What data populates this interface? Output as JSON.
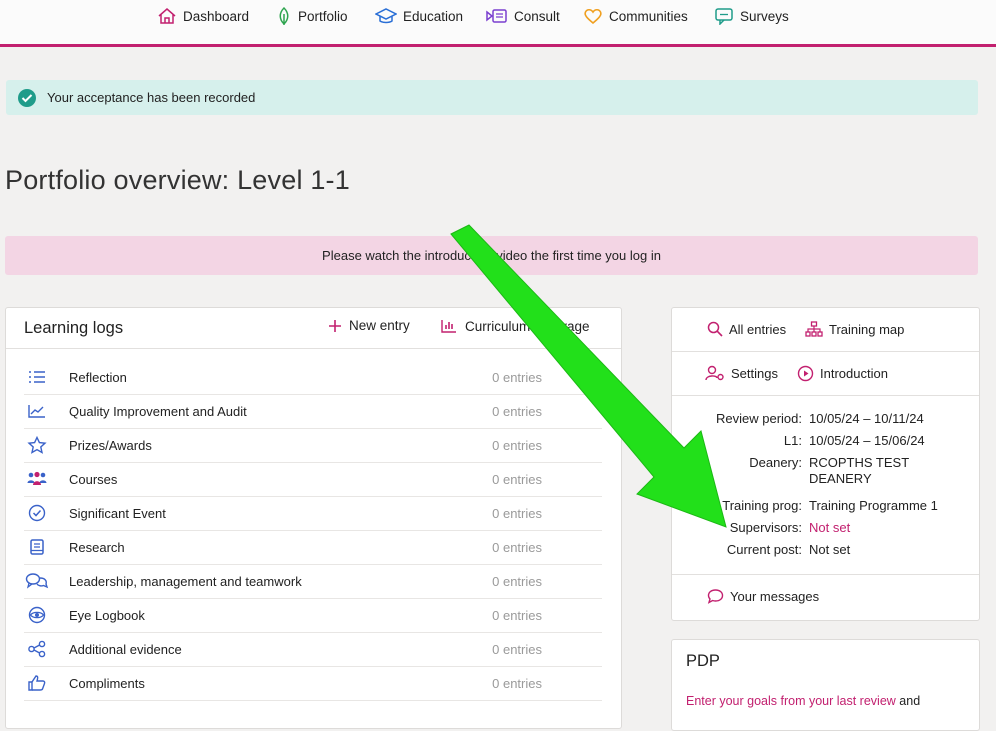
{
  "nav": {
    "items": [
      {
        "label": "Dashboard",
        "icon": "home-icon"
      },
      {
        "label": "Portfolio",
        "icon": "leaf-icon"
      },
      {
        "label": "Education",
        "icon": "graduation-cap-icon"
      },
      {
        "label": "Consult",
        "icon": "video-call-icon"
      },
      {
        "label": "Communities",
        "icon": "heart-icon"
      },
      {
        "label": "Surveys",
        "icon": "chat-survey-icon"
      }
    ]
  },
  "alert": {
    "text": "Your acceptance has been recorded"
  },
  "page": {
    "title": "Portfolio overview: Level 1-1"
  },
  "notice": {
    "text": "Please watch the introductory video the first time you log in"
  },
  "logs": {
    "title": "Learning logs",
    "new_entry": "New entry",
    "curriculum": "Curriculum coverage",
    "rows": [
      {
        "label": "Reflection",
        "count": "0 entries",
        "icon": "list-icon"
      },
      {
        "label": "Quality Improvement and Audit",
        "count": "0 entries",
        "icon": "line-chart-icon"
      },
      {
        "label": "Prizes/Awards",
        "count": "0 entries",
        "icon": "star-icon"
      },
      {
        "label": "Courses",
        "count": "0 entries",
        "icon": "group-icon"
      },
      {
        "label": "Significant Event",
        "count": "0 entries",
        "icon": "check-circle-icon"
      },
      {
        "label": "Research",
        "count": "0 entries",
        "icon": "book-icon"
      },
      {
        "label": "Leadership, management and teamwork",
        "count": "0 entries",
        "icon": "chat-bubbles-icon"
      },
      {
        "label": "Eye Logbook",
        "count": "0 entries",
        "icon": "eye-icon"
      },
      {
        "label": "Additional evidence",
        "count": "0 entries",
        "icon": "share-icon"
      },
      {
        "label": "Compliments",
        "count": "0 entries",
        "icon": "thumbs-up-icon"
      }
    ]
  },
  "side": {
    "all_entries": "All entries",
    "training_map": "Training map",
    "settings": "Settings",
    "introduction": "Introduction",
    "info": [
      {
        "key": "Review period:",
        "value": "10/05/24 – 10/11/24"
      },
      {
        "key": "L1:",
        "value": "10/05/24 – 15/06/24"
      },
      {
        "key": "Deanery:",
        "value": "RCOPTHS TEST DEANERY"
      },
      {
        "key": "Training prog:",
        "value": "Training Programme 1"
      },
      {
        "key": "Supervisors:",
        "value": "Not set"
      },
      {
        "key": "Current post:",
        "value": "Not set"
      }
    ],
    "messages": "Your messages"
  },
  "pdp": {
    "title": "PDP",
    "link": "Enter your goals from your last review",
    "rest": " and"
  },
  "colors": {
    "accent": "#c2206f",
    "success": "#1f9c8a",
    "arrow": "#22e01a"
  }
}
